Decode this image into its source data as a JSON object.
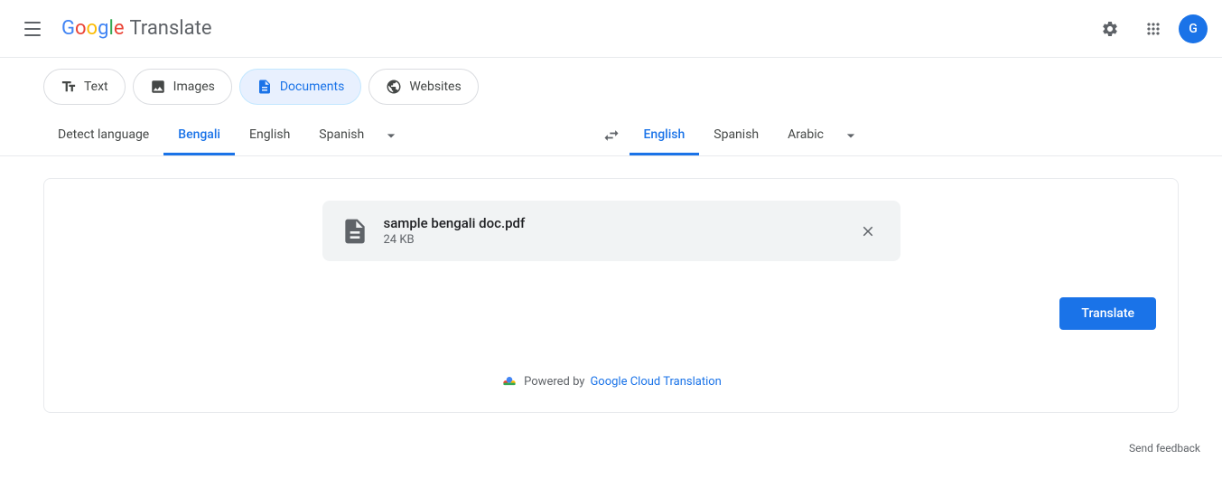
{
  "header": {
    "app_name": "Translate",
    "google_letters": [
      "G",
      "o",
      "o",
      "g",
      "l",
      "e"
    ],
    "settings_icon": "settings-icon",
    "apps_icon": "apps-icon",
    "avatar_letter": "G"
  },
  "mode_tabs": [
    {
      "id": "text",
      "label": "Text",
      "icon": "text-icon"
    },
    {
      "id": "images",
      "label": "Images",
      "icon": "image-icon"
    },
    {
      "id": "documents",
      "label": "Documents",
      "icon": "document-icon",
      "active": true
    },
    {
      "id": "websites",
      "label": "Websites",
      "icon": "globe-icon"
    }
  ],
  "source_lang": {
    "detect": "Detect language",
    "bengali": "Bengali",
    "english": "English",
    "spanish": "Spanish",
    "more_icon": "chevron-down-icon",
    "active": "Bengali"
  },
  "swap_icon": "swap-icon",
  "target_lang": {
    "english": "English",
    "spanish": "Spanish",
    "arabic": "Arabic",
    "more_icon": "chevron-down-icon",
    "active": "English"
  },
  "file": {
    "name": "sample bengali doc.pdf",
    "size": "24 KB",
    "file_icon": "pdf-icon",
    "close_icon": "close-icon"
  },
  "translate_button": "Translate",
  "powered_by": {
    "prefix": "Powered by",
    "link_text": "Google Cloud Translation",
    "link_icon": "google-cloud-icon"
  },
  "footer": {
    "send_feedback": "Send feedback"
  }
}
